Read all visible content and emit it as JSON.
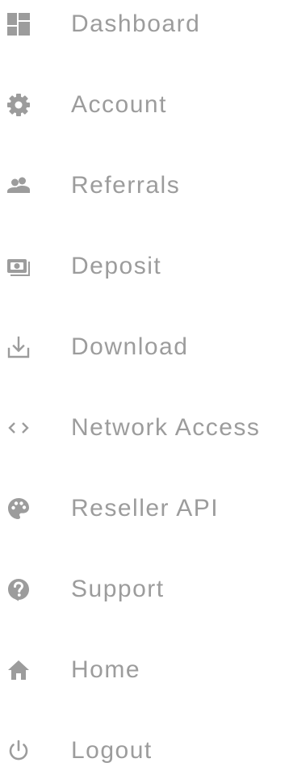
{
  "sidebar": {
    "items": [
      {
        "label": "Dashboard",
        "icon": "dashboard-icon"
      },
      {
        "label": "Account",
        "icon": "gear-icon"
      },
      {
        "label": "Referrals",
        "icon": "people-icon"
      },
      {
        "label": "Deposit",
        "icon": "wallet-icon"
      },
      {
        "label": "Download",
        "icon": "download-icon"
      },
      {
        "label": "Network Access",
        "icon": "code-brackets-icon"
      },
      {
        "label": "Reseller API",
        "icon": "palette-icon"
      },
      {
        "label": "Support",
        "icon": "question-icon"
      },
      {
        "label": "Home",
        "icon": "home-icon"
      },
      {
        "label": "Logout",
        "icon": "power-icon"
      }
    ],
    "colors": {
      "text": "#9c9c9c",
      "icon": "#9c9c9c",
      "background": "#ffffff"
    }
  }
}
